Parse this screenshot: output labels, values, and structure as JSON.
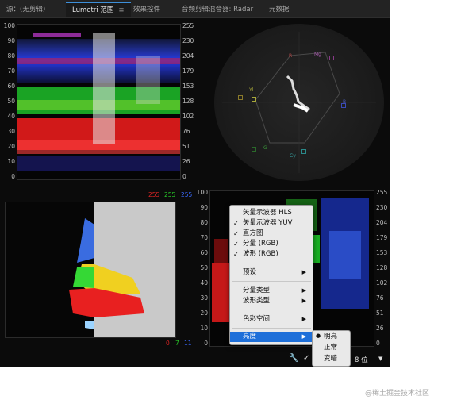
{
  "tabs": [
    {
      "label": "源：(无剪辑)"
    },
    {
      "label": "Lumetri 范围"
    },
    {
      "label": "效果控件"
    },
    {
      "label": "音频剪辑混合器: Radar"
    },
    {
      "label": "元数据"
    }
  ],
  "tab_menu_icon": "≡",
  "waveform_axis_left": [
    "100",
    "90",
    "80",
    "70",
    "60",
    "50",
    "40",
    "30",
    "20",
    "10",
    "0"
  ],
  "waveform_axis_right": [
    "255",
    "230",
    "204",
    "179",
    "153",
    "128",
    "102",
    "76",
    "51",
    "26",
    "0"
  ],
  "vectorscope_labels": [
    {
      "text": "R",
      "color": "#b84a4a"
    },
    {
      "text": "Mg",
      "color": "#a25aa8"
    },
    {
      "text": "B",
      "color": "#4a5ab8"
    },
    {
      "text": "Cy",
      "color": "#3aa7a7"
    },
    {
      "text": "G",
      "color": "#3a9a3a"
    },
    {
      "text": "Yl",
      "color": "#a8a83a"
    }
  ],
  "histogram_header": {
    "r": "255",
    "g": "255",
    "b": "255"
  },
  "histogram_footer": {
    "r": "0",
    "g": "7",
    "b": "11"
  },
  "parade_axis_left": [
    "100",
    "90",
    "80",
    "70",
    "60",
    "50",
    "40",
    "30",
    "20",
    "10",
    "0"
  ],
  "parade_axis_right": [
    "255",
    "230",
    "204",
    "179",
    "153",
    "128",
    "102",
    "76",
    "51",
    "26",
    "0"
  ],
  "context_menu": {
    "items": [
      {
        "label": "矢量示波器 HLS",
        "checked": false
      },
      {
        "label": "矢量示波器 YUV",
        "checked": true
      },
      {
        "label": "直方图",
        "checked": true
      },
      {
        "label": "分量 (RGB)",
        "checked": true
      },
      {
        "label": "波形 (RGB)",
        "checked": true
      },
      {
        "label": "预设",
        "submenu": true
      },
      {
        "label": "分量类型",
        "submenu": true
      },
      {
        "label": "波形类型",
        "submenu": true
      },
      {
        "label": "色彩空间",
        "submenu": true
      },
      {
        "label": "亮度",
        "submenu": true,
        "selected": true
      }
    ],
    "check_glyph": "✓",
    "arrow_glyph": "▶"
  },
  "brightness_submenu": {
    "items": [
      {
        "label": "明亮",
        "selected": true
      },
      {
        "label": "正常"
      },
      {
        "label": "变暗"
      }
    ]
  },
  "bottom_bar": {
    "wrench": "wrench-icon",
    "check": "✓",
    "bit_depth": "8 位",
    "dropdown": "▼"
  },
  "watermark": "@稀土掘金技术社区",
  "colors": {
    "accent": "#1e6fd9",
    "red": "#e82020",
    "green": "#25d025",
    "blue": "#2a4de8"
  }
}
